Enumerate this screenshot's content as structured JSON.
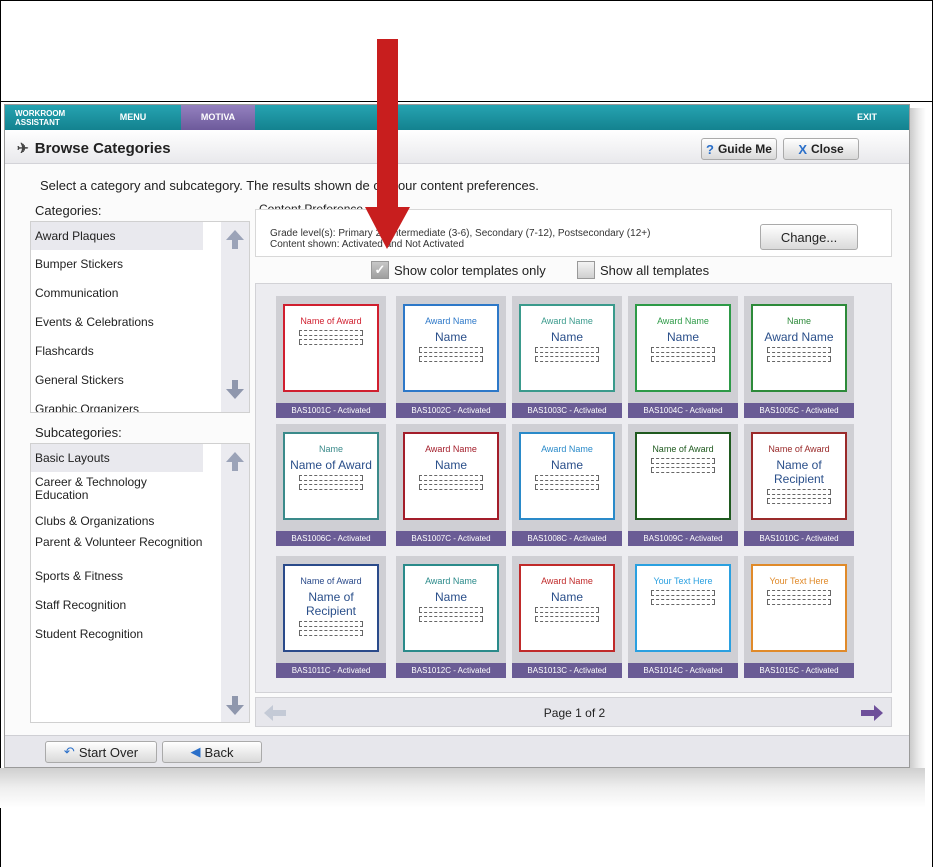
{
  "topbar": {
    "workroom_label": "WORKROOM ASSISTANT",
    "menu_label": "MENU",
    "motiva_label": "MOTIVA",
    "exit_label": "EXIT"
  },
  "header": {
    "title": "Browse Categories",
    "guide_label": "Guide Me",
    "close_label": "Close"
  },
  "instruction": "Select a category and subcategory. The results shown de      on your content preferences.",
  "categories": {
    "label": "Categories:",
    "items": [
      "Award Plaques",
      "Bumper Stickers",
      "Communication",
      "Events & Celebrations",
      "Flashcards",
      "General Stickers",
      "Graphic Organizers"
    ],
    "selected": "Award Plaques"
  },
  "subcategories": {
    "label": "Subcategories:",
    "items": [
      "Basic Layouts",
      "Career & Technology Education",
      "Clubs & Organizations",
      "Parent & Volunteer Recognition",
      "Sports & Fitness",
      "Staff Recognition",
      "Student Recognition"
    ],
    "selected": "Basic Layouts"
  },
  "preferences": {
    "label": "Content Preference",
    "grades": "Grade level(s): Primary      2), Intermediate (3-6), Secondary (7-12), Postsecondary (12+)",
    "shown": "Content shown: Activated and Not Activated",
    "change_label": "Change..."
  },
  "filters": {
    "color_only_label": "Show color templates only",
    "color_only_checked": true,
    "all_label": "Show all templates",
    "all_checked": false
  },
  "templates": [
    {
      "id": "BAS1001C - Activated",
      "title": "Name of Award",
      "name": "",
      "accent": "#d01f2f"
    },
    {
      "id": "BAS1002C - Activated",
      "title": "Award Name",
      "name": "Name",
      "accent": "#2d78c8"
    },
    {
      "id": "BAS1003C - Activated",
      "title": "Award Name",
      "name": "Name",
      "accent": "#3a9a8c"
    },
    {
      "id": "BAS1004C - Activated",
      "title": "Award Name",
      "name": "Name",
      "accent": "#2d9a47"
    },
    {
      "id": "BAS1005C - Activated",
      "title": "Name",
      "name": "Award Name",
      "accent": "#2d8a3a"
    },
    {
      "id": "BAS1006C - Activated",
      "title": "Name",
      "name": "Name of Award",
      "accent": "#3a8a8a"
    },
    {
      "id": "BAS1007C - Activated",
      "title": "Award Name",
      "name": "Name",
      "accent": "#a31d2a"
    },
    {
      "id": "BAS1008C - Activated",
      "title": "Award Name",
      "name": "Name",
      "accent": "#2a8ac9"
    },
    {
      "id": "BAS1009C - Activated",
      "title": "Name of Award",
      "name": "",
      "accent": "#1f5a1f"
    },
    {
      "id": "BAS1010C - Activated",
      "title": "Name of Award",
      "name": "Name of Recipient",
      "accent": "#9a2a2a"
    },
    {
      "id": "BAS1011C - Activated",
      "title": "Name of Award",
      "name": "Name of Recipient",
      "accent": "#2a4a8a"
    },
    {
      "id": "BAS1012C - Activated",
      "title": "Award Name",
      "name": "Name",
      "accent": "#2a8a8a"
    },
    {
      "id": "BAS1013C - Activated",
      "title": "Award Name",
      "name": "Name",
      "accent": "#c02a2a"
    },
    {
      "id": "BAS1014C - Activated",
      "title": "Your Text Here",
      "name": "",
      "accent": "#2aa0e0"
    },
    {
      "id": "BAS1015C - Activated",
      "title": "Your Text Here",
      "name": "",
      "accent": "#e08a2a"
    }
  ],
  "pager": {
    "label": "Page 1 of 2"
  },
  "footer": {
    "start_over_label": "Start Over",
    "back_label": "Back"
  }
}
